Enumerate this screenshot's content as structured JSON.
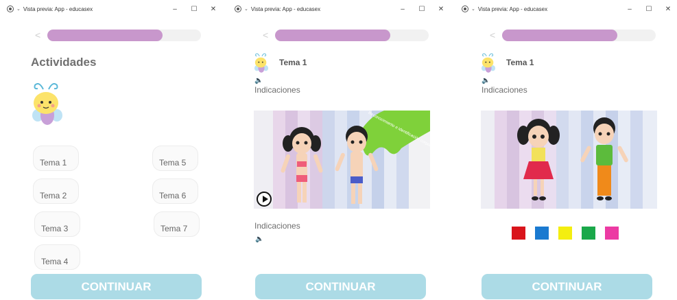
{
  "window": {
    "title": "Vista previa: App - educasex",
    "minimize_glyph": "–",
    "maximize_glyph": "☐",
    "close_glyph": "✕"
  },
  "screen1": {
    "back_glyph": "<",
    "progress": 0.75,
    "heading": "Actividades",
    "temas": [
      "Tema 1",
      "Tema 5",
      "Tema 2",
      "Tema 6",
      "Tema 3",
      "Tema 7",
      "Tema 4"
    ],
    "continue_label": "CONTINUAR"
  },
  "screen2": {
    "back_glyph": "<",
    "progress": 0.75,
    "tema_title": "Tema 1",
    "speaker_glyph": "🔈",
    "indicaciones_top": "Indicaciones",
    "banner_text": "Reconocimiento e identificación corporal",
    "indicaciones_bottom": "Indicaciones",
    "continue_label": "CONTINUAR"
  },
  "screen3": {
    "back_glyph": "<",
    "progress": 0.75,
    "tema_title": "Tema 1",
    "speaker_glyph": "🔈",
    "indicaciones": "Indicaciones",
    "swatch_colors": [
      "#d9141b",
      "#1a7ad0",
      "#f4ee10",
      "#1aa84a",
      "#ec3aa3"
    ],
    "continue_label": "CONTINUAR"
  },
  "colors": {
    "progress_fill": "#c897cc",
    "continue_bg": "#acdbe6"
  }
}
